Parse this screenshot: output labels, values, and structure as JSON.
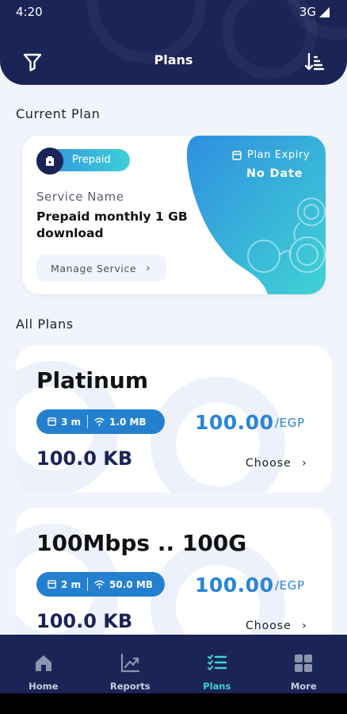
{
  "status_bar": {
    "time": "4:20",
    "network": "3G"
  },
  "header": {
    "title": "Plans"
  },
  "current_plan": {
    "section_title": "Current Plan",
    "type_label": "Prepaid",
    "service_label": "Service Name",
    "service_name": "Prepaid monthly 1 GB download",
    "manage_label": "Manage Service",
    "expiry_label": "Plan Expiry",
    "expiry_value": "No Date"
  },
  "all_plans": {
    "section_title": "All Plans",
    "plans": [
      {
        "name": "Platinum",
        "duration": "3 m",
        "speed": "1.0 MB",
        "price": "100.00",
        "currency": "/EGP",
        "data": "100.0 KB",
        "choose_label": "Choose"
      },
      {
        "name": "100Mbps .. 100G",
        "duration": "2 m",
        "speed": "50.0 MB",
        "price": "100.00",
        "currency": "/EGP",
        "data": "100.0 KB",
        "choose_label": "Choose"
      }
    ]
  },
  "bottom_nav": {
    "items": [
      {
        "label": "Home",
        "icon": "home-icon"
      },
      {
        "label": "Reports",
        "icon": "chart-icon"
      },
      {
        "label": "Plans",
        "icon": "list-check-icon",
        "active": true
      },
      {
        "label": "More",
        "icon": "grid-icon"
      }
    ]
  },
  "colors": {
    "navy": "#1b2456",
    "accent_blue": "#2a85d6",
    "accent_teal": "#3ed0d7",
    "background": "#f1f4fb"
  }
}
